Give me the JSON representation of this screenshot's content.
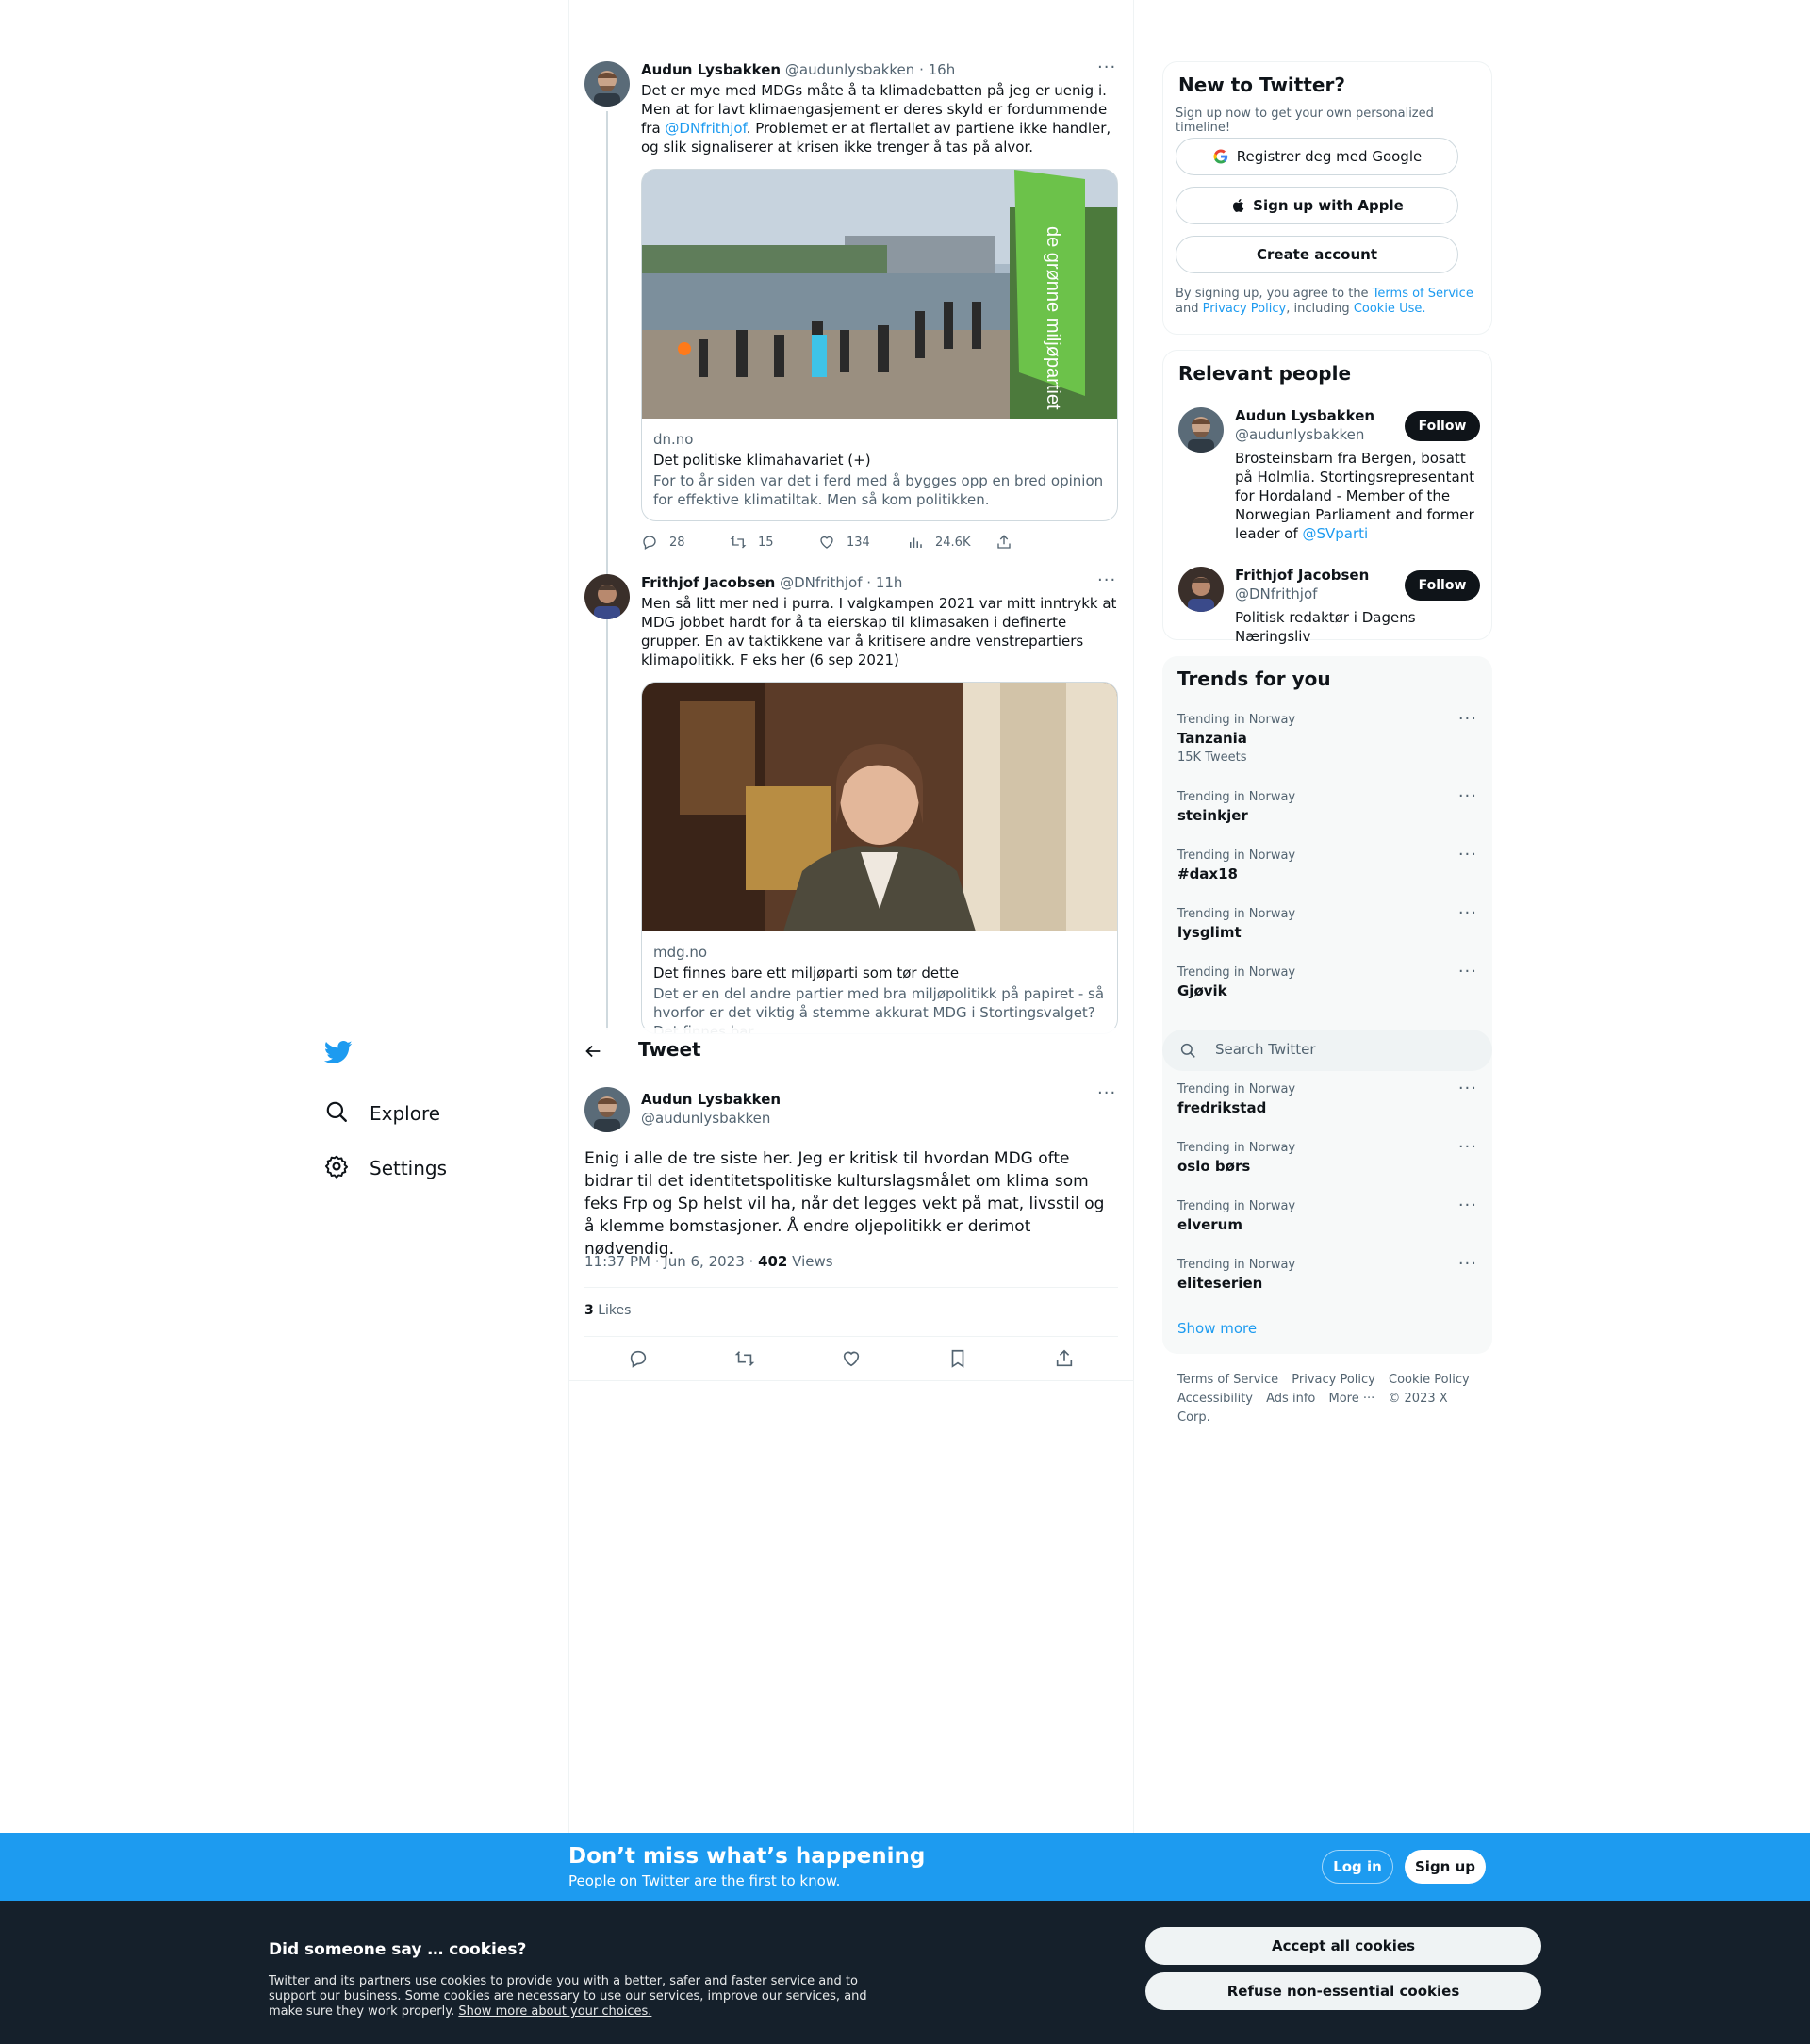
{
  "nav": {
    "items": [
      {
        "label": "Explore",
        "icon": "search-icon"
      },
      {
        "label": "Settings",
        "icon": "gear-icon"
      }
    ]
  },
  "thread": [
    {
      "name": "Audun Lysbakken",
      "handle": "@audunlysbakken",
      "age": "16h",
      "text_before": "Det er mye med MDGs måte å ta klimadebatten på jeg er uenig i. Men at for lavt klimaengasjement er deres skyld er fordummende fra ",
      "mention": "@DNfrithjof",
      "text_after": ". Problemet er at flertallet av partiene ikke handler, og slik signaliserer at krisen ikke trenger å tas på alvor.",
      "card": {
        "domain": "dn.no",
        "title": "Det politiske klimahavariet (+)",
        "description": "For to år siden var det i ferd med å bygges opp en bred opinion for effektive klimatiltak. Men så kom politikken.",
        "banner_text": "de grønne miljøpartiet"
      },
      "stats": {
        "replies": "28",
        "retweets": "15",
        "likes": "134",
        "views": "24.6K"
      }
    },
    {
      "name": "Frithjof Jacobsen",
      "handle": "@DNfrithjof",
      "age": "11h",
      "text": "Men så litt mer ned i purra. I valgkampen 2021 var mitt inntrykk at MDG jobbet hardt for å ta eierskap til klimasaken i definerte grupper. En av taktikkene var å kritisere andre venstrepartiers klimapolitikk. F eks her (6 sep 2021)",
      "card": {
        "domain": "mdg.no",
        "title": "Det finnes bare ett miljøparti som tør dette",
        "description": "Det er en del andre partier med bra miljøpolitikk på papiret - så hvorfor er det viktig å stemme akkurat MDG i Stortingsvalget? Det finnes bar..."
      }
    }
  ],
  "header": {
    "title": "Tweet"
  },
  "focal": {
    "name": "Audun Lysbakken",
    "handle": "@audunlysbakken",
    "text": "Enig i alle de tre siste her. Jeg er kritisk til hvordan MDG ofte bidrar til det identitetspolitiske kulturslagsmålet om klima som feks Frp og Sp helst vil ha, når det legges vekt på mat, livsstil og å klemme bomstasjoner.  Å endre oljepolitikk er derimot nødvendig.",
    "time": "11:37 PM · Jun 6, 2023 · ",
    "views_count": "402",
    "views_label": " Views",
    "likes_count": "3",
    "likes_label": " Likes"
  },
  "signup_panel": {
    "title": "New to Twitter?",
    "subtitle": "Sign up now to get your own personalized timeline!",
    "google_label": "Registrer deg med Google",
    "apple_label": "Sign up with Apple",
    "create_label": "Create account",
    "legal_1": "By signing up, you agree to the ",
    "terms": "Terms of Service",
    "legal_2": " and ",
    "privacy": "Privacy Policy",
    "legal_3": ", including ",
    "cookie_use": "Cookie Use."
  },
  "relevant_people": {
    "title": "Relevant people",
    "people": [
      {
        "name": "Audun Lysbakken",
        "handle": "@audunlysbakken",
        "bio_before": "Brosteinsbarn fra Bergen, bosatt på Holmlia. Stortingsrepresentant for Hordaland - Member of the Norwegian Parliament and former leader of ",
        "bio_mention": "@SVparti",
        "follow": "Follow"
      },
      {
        "name": "Frithjof Jacobsen",
        "handle": "@DNfrithjof",
        "bio": "Politisk redaktør i Dagens Næringsliv",
        "follow": "Follow"
      }
    ]
  },
  "trends": {
    "title": "Trends for you",
    "items": [
      {
        "context": "Trending in Norway",
        "name": "Tanzania",
        "count": "15K Tweets"
      },
      {
        "context": "Trending in Norway",
        "name": "steinkjer"
      },
      {
        "context": "Trending in Norway",
        "name": "#dax18"
      },
      {
        "context": "Trending in Norway",
        "name": "lysglimt"
      },
      {
        "context": "Trending in Norway",
        "name": "Gjøvik"
      },
      {
        "context": "Trending in Norway",
        "name": "fredrikstad"
      },
      {
        "context": "Trending in Norway",
        "name": "oslo børs"
      },
      {
        "context": "Trending in Norway",
        "name": "elverum"
      },
      {
        "context": "Trending in Norway",
        "name": "eliteserien"
      }
    ],
    "show_more": "Show more"
  },
  "search": {
    "placeholder": "Search Twitter"
  },
  "footer": {
    "links": [
      "Terms of Service",
      "Privacy Policy",
      "Cookie Policy",
      "Accessibility",
      "Ads info",
      "More ···",
      "© 2023 X Corp."
    ]
  },
  "banner": {
    "title": "Don’t miss what’s happening",
    "subtitle": "People on Twitter are the first to know.",
    "login": "Log in",
    "signup": "Sign up"
  },
  "cookies": {
    "title": "Did someone say … cookies?",
    "body": "Twitter and its partners use cookies to provide you with a better, safer and faster service and to support our business. Some cookies are necessary to use our services, improve our services, and make sure they work properly. ",
    "link": "Show more about your choices.",
    "accept": "Accept all cookies",
    "refuse": "Refuse non-essential cookies"
  },
  "colors": {
    "accent": "#1d9bf0",
    "text": "#0f1419",
    "muted": "#536471",
    "dark_bg": "#15202b"
  }
}
